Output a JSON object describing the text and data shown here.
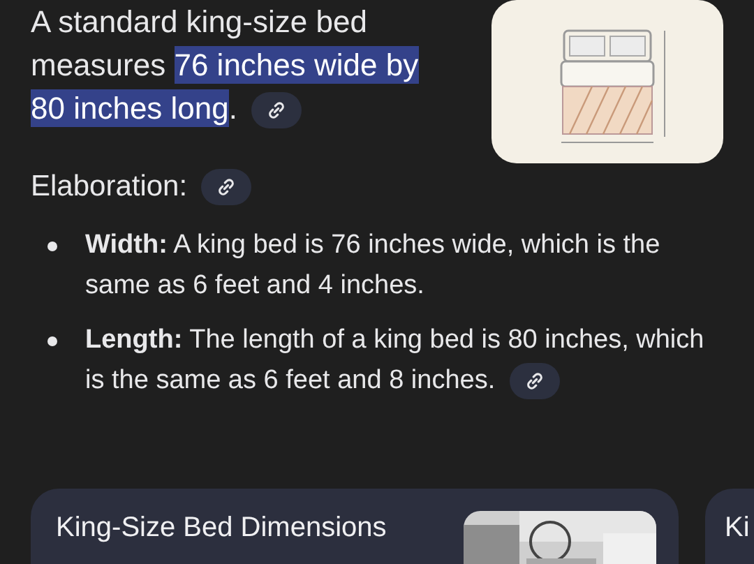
{
  "summary": {
    "parts": [
      {
        "text": "A standard king-size bed measures ",
        "highlighted": false
      },
      {
        "text": "76 inches wide by 80 inches long",
        "highlighted": true
      },
      {
        "text": ".",
        "highlighted": false
      }
    ]
  },
  "elaboration": {
    "heading": "Elaboration:"
  },
  "bullets": [
    {
      "term": "Width:",
      "text": " A king bed is 76 inches wide, which is the same as 6 feet and 4 inches.",
      "link": false
    },
    {
      "term": "Length:",
      "text": " The length of a king bed is 80 inches, which is the same as 6 feet and 8 inches.",
      "link": true
    }
  ],
  "cards": [
    {
      "title": "King-Size Bed Dimensions",
      "picture": true
    },
    {
      "title": "Ki",
      "picture": false
    }
  ]
}
